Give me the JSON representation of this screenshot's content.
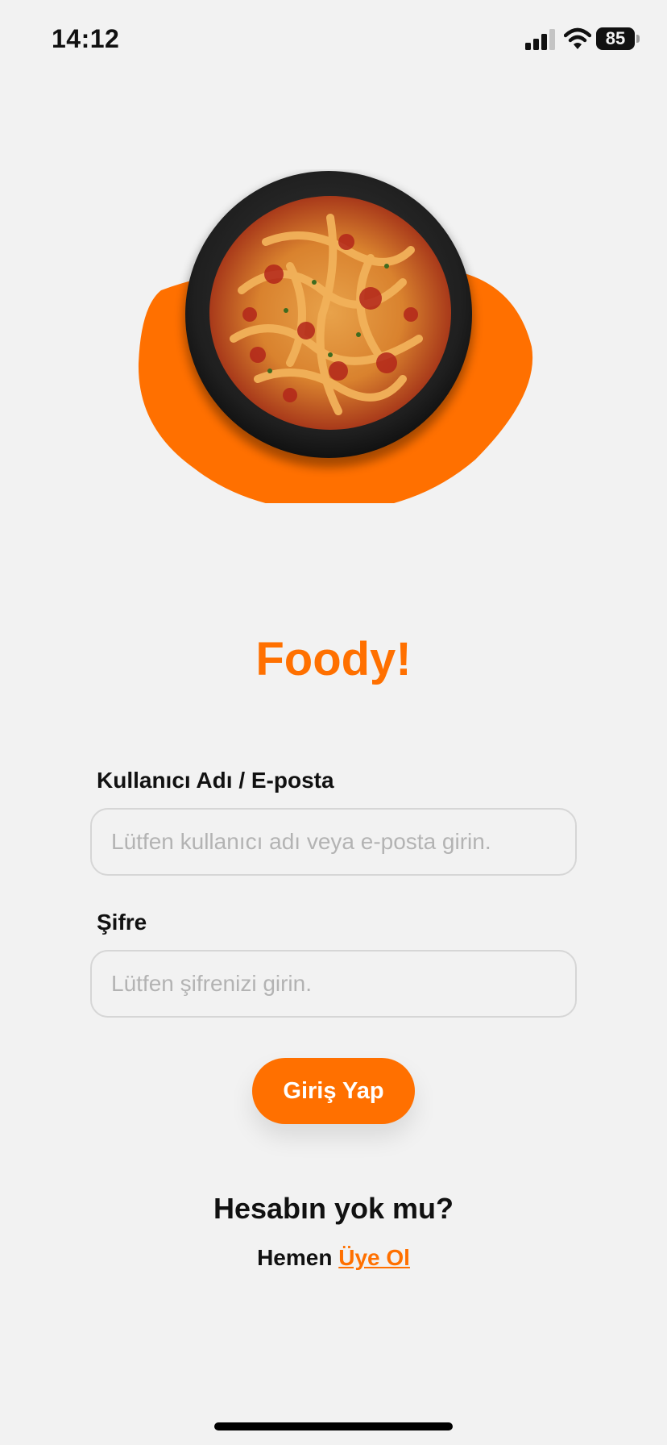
{
  "status_bar": {
    "time": "14:12",
    "battery": "85"
  },
  "app": {
    "title": "Foody!"
  },
  "form": {
    "username_label": "Kullanıcı Adı / E-posta",
    "username_placeholder": "Lütfen kullanıcı adı veya e-posta girin.",
    "username_value": "",
    "password_label": "Şifre",
    "password_placeholder": "Lütfen şifrenizi girin.",
    "password_value": "",
    "login_button": "Giriş Yap"
  },
  "signup": {
    "question": "Hesabın yok mu?",
    "prefix": "Hemen ",
    "link": "Üye Ol"
  },
  "colors": {
    "accent": "#ff7000",
    "background": "#f2f2f2",
    "text": "#111111"
  },
  "icons": [
    "cellular-signal-icon",
    "wifi-icon",
    "battery-icon"
  ]
}
